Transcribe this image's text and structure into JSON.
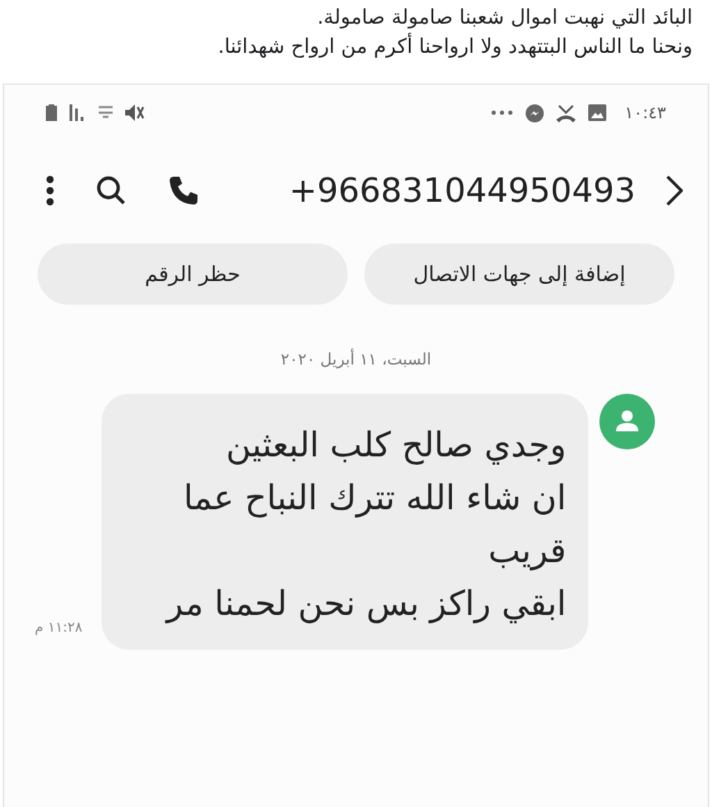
{
  "post": {
    "lines": [
      "البائد التي نهبت اموال شعبنا صامولة صامولة.",
      "ونحنا ما الناس البتتهدد ولا ارواحنا أكرم من ارواح شهدائنا."
    ]
  },
  "status_bar": {
    "time": "١٠:٤٣"
  },
  "header": {
    "number": "+966831044950493"
  },
  "actions": [
    {
      "label": "إضافة إلى جهات الاتصال"
    },
    {
      "label": "حظر الرقم"
    }
  ],
  "date": "السبت، ١١ أبريل ٢٠٢٠",
  "message": {
    "lines": [
      "وجدي صالح كلب البعثين",
      "ان شاء الله تترك النباح عما",
      "قريب",
      "ابقي راكز بس نحن لحمنا مر"
    ],
    "time": "١١:٢٨ م"
  }
}
